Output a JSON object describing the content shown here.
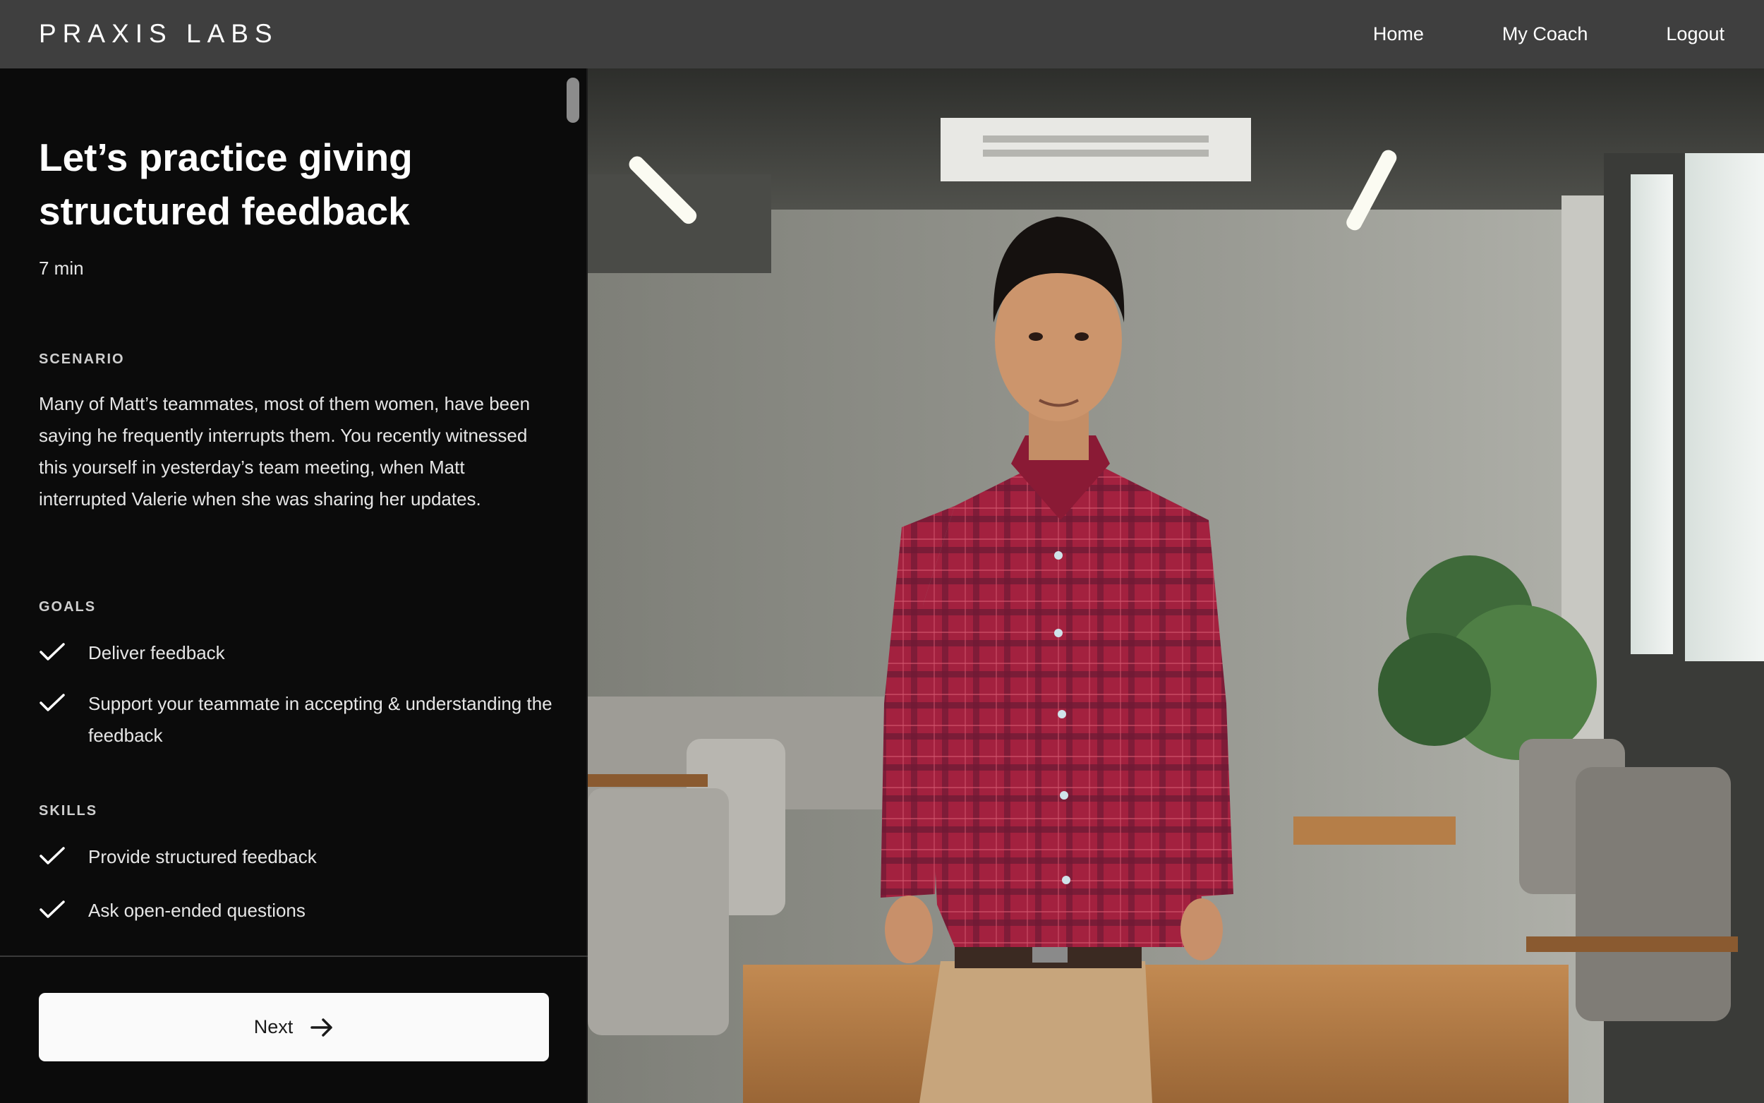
{
  "brand": {
    "logo_text": "PRAXIS LABS"
  },
  "nav": {
    "home": "Home",
    "coach": "My Coach",
    "logout": "Logout"
  },
  "lesson": {
    "title": "Let’s practice giving structured feedback",
    "duration": "7 min",
    "scenario_label": "SCENARIO",
    "scenario_text": "Many of Matt’s teammates, most of them women, have been saying he frequently interrupts them. You recently witnessed this yourself in yesterday’s team meeting, when Matt interrupted Valerie when she was sharing her updates.",
    "goals_label": "GOALS",
    "goals": [
      "Deliver feedback",
      "Support your teammate in accepting & understanding the feedback"
    ],
    "skills_label": "SKILLS",
    "skills": [
      "Provide structured feedback",
      "Ask open-ended questions"
    ]
  },
  "footer": {
    "next_label": "Next"
  },
  "icons": {
    "check": "check-icon",
    "arrow": "arrow-right-icon"
  },
  "colors": {
    "topbar": "#3f3f3f",
    "panel": "#0b0b0b",
    "button": "#fafafa",
    "shirt": "#9c1f3a"
  }
}
